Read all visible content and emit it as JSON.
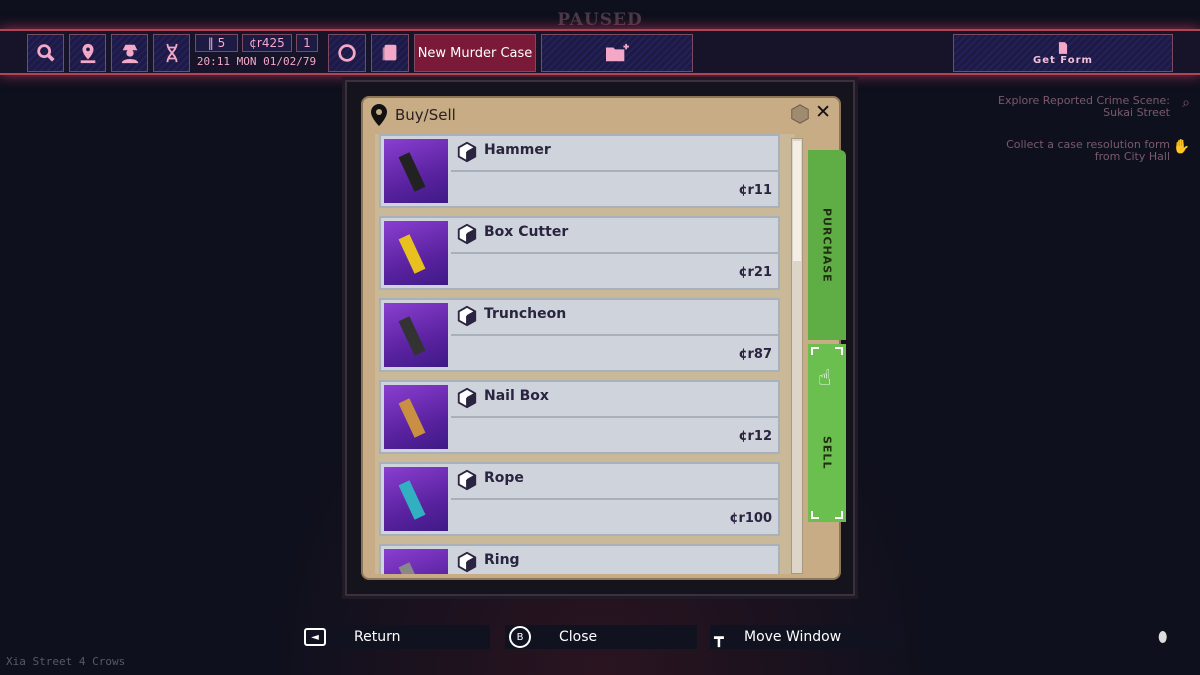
{
  "status": "PAUSED",
  "topbar": {
    "icons": [
      "magnifier-icon",
      "map-pin-icon",
      "detective-icon",
      "dna-icon"
    ],
    "ammo": "5",
    "money": "¢r425",
    "stars": "1",
    "clock": "20:11 MON 01/02/79",
    "new_case": "New Murder Case",
    "get_form": "Get Form"
  },
  "objectives": [
    {
      "text": "Explore Reported Crime Scene: Sukai Street",
      "icon": "magnifier-icon"
    },
    {
      "text": "Collect a case resolution form from City Hall",
      "icon": "hand-icon"
    }
  ],
  "window": {
    "title": "Buy/Sell",
    "tabs": {
      "purchase": "PURCHASE",
      "sell": "SELL"
    }
  },
  "items": [
    {
      "name": "Hammer",
      "price": "¢r11"
    },
    {
      "name": "Box Cutter",
      "price": "¢r21"
    },
    {
      "name": "Truncheon",
      "price": "¢r87"
    },
    {
      "name": "Nail Box",
      "price": "¢r12"
    },
    {
      "name": "Rope",
      "price": "¢r100"
    },
    {
      "name": "Ring",
      "price": ""
    }
  ],
  "footer": {
    "return": "Return",
    "return_key": "◄",
    "close": "Close",
    "close_key": "B",
    "move": "Move Window"
  },
  "location": "Xia Street 4 Crows",
  "colors": {
    "accent": "#f4a8c8",
    "purchase_tab": "#5fae45",
    "sell_tab": "#6abf4e",
    "murder_case": "#7a1a38"
  }
}
